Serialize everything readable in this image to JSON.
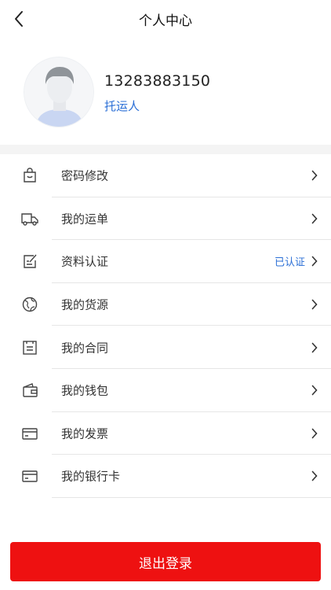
{
  "header": {
    "title": "个人中心",
    "back_icon": "back-arrow-icon"
  },
  "profile": {
    "phone": "13283883150",
    "role": "托运人"
  },
  "menu": [
    {
      "label": "密码修改",
      "icon": "shopping-bag-icon",
      "status": ""
    },
    {
      "label": "我的运单",
      "icon": "truck-icon",
      "status": ""
    },
    {
      "label": "资料认证",
      "icon": "edit-note-icon",
      "status": "已认证"
    },
    {
      "label": "我的货源",
      "icon": "globe-icon",
      "status": ""
    },
    {
      "label": "我的合同",
      "icon": "contract-icon",
      "status": ""
    },
    {
      "label": "我的钱包",
      "icon": "wallet-icon",
      "status": ""
    },
    {
      "label": "我的发票",
      "icon": "invoice-card-icon",
      "status": ""
    },
    {
      "label": "我的银行卡",
      "icon": "bank-card-icon",
      "status": ""
    }
  ],
  "logout": {
    "label": "退出登录"
  },
  "colors": {
    "accent": "#2b6fd6",
    "danger": "#ee1111",
    "text": "#333333",
    "divider": "#e6e6e6"
  }
}
